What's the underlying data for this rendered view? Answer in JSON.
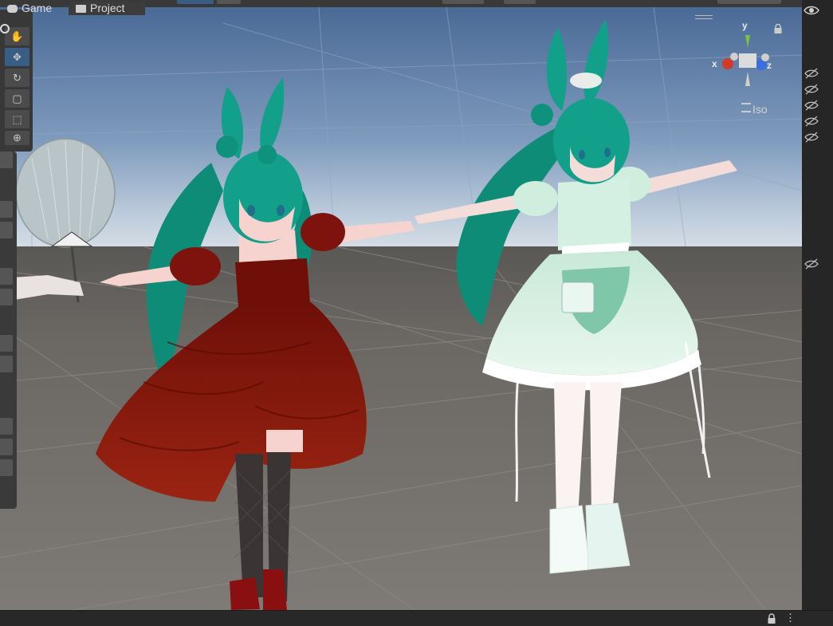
{
  "toolbar": {
    "buttons": [
      "toolbar-tool-a",
      "toolbar-tool-b",
      "toolbar-tool-c"
    ]
  },
  "scene_view": {
    "projection_label": "Iso",
    "gizmo": {
      "x": "x",
      "y": "y",
      "z": "z"
    },
    "tools": [
      "view-tool",
      "move-tool",
      "rotate-tool",
      "scale-tool",
      "rect-tool",
      "transform-tool"
    ]
  },
  "bottom_tabs": {
    "game": "Game",
    "project": "Project"
  },
  "colors": {
    "scene_floor": "#7e7a76",
    "sky_top": "#4f6f9a",
    "sky_horizon": "#c9d6e2",
    "accent_active": "#3a5d86",
    "axis_x": "#d23a2a",
    "axis_y": "#7cc242",
    "axis_z": "#3c6ee0",
    "hair_teal": "#13a08a",
    "dress_red": "#8a1a10",
    "dress_mint": "#d8f0e4"
  }
}
